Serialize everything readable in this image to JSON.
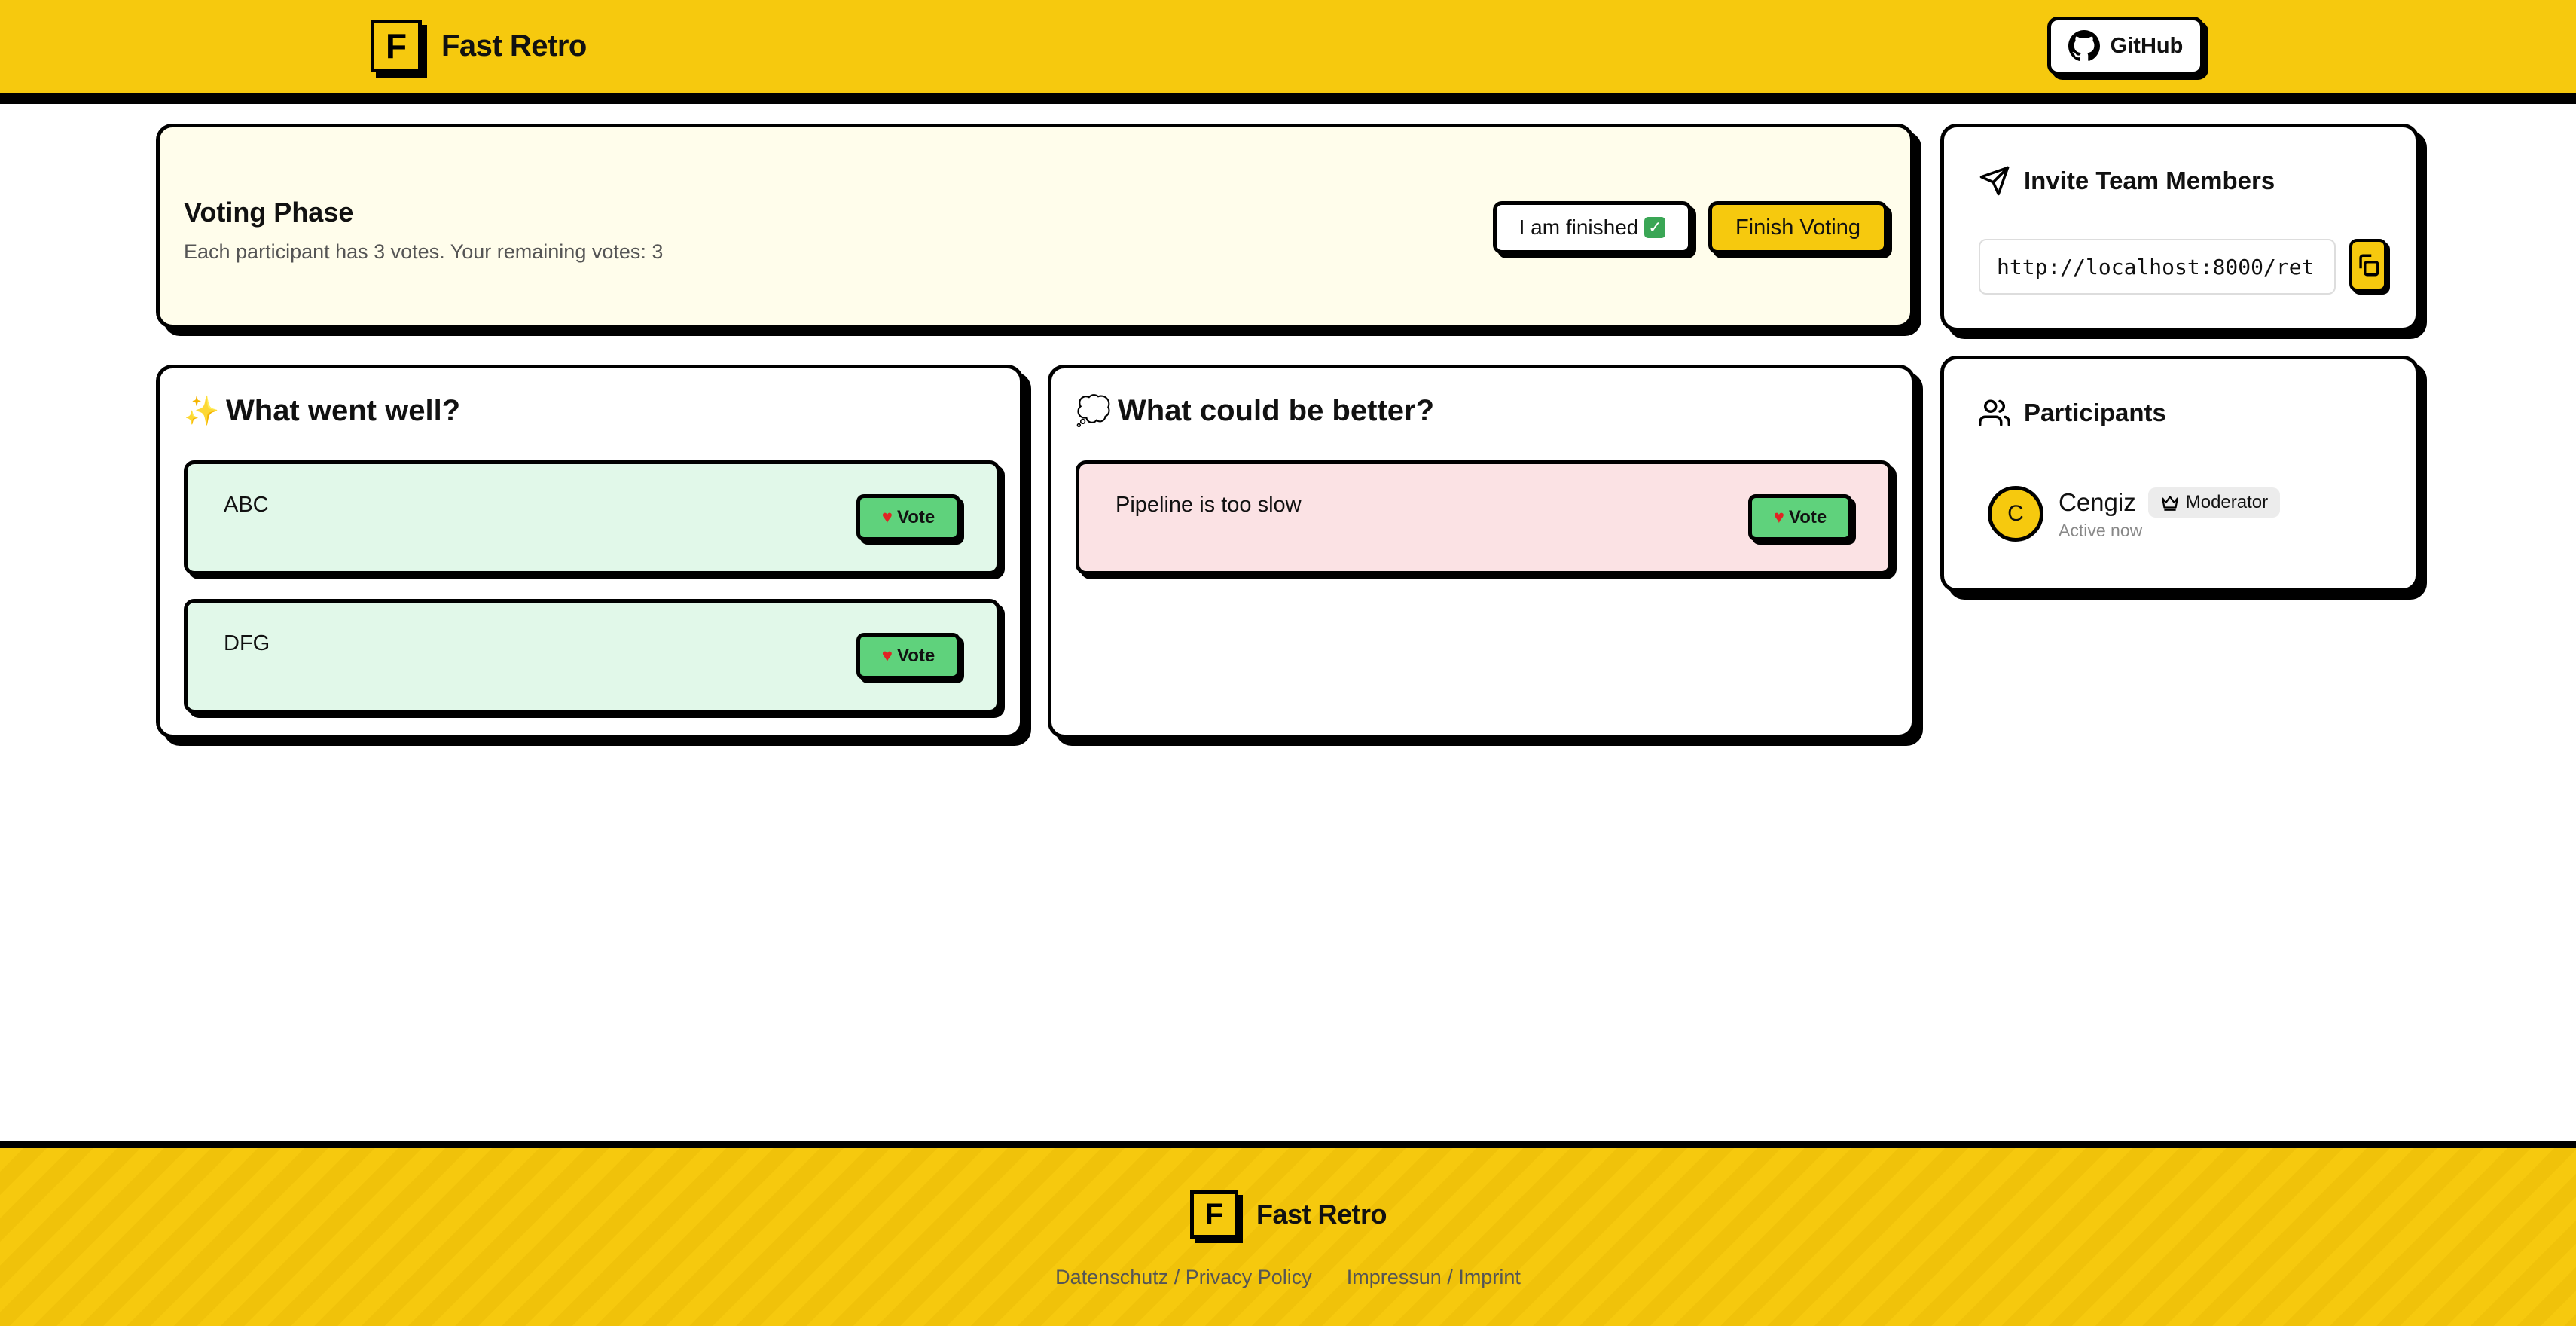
{
  "header": {
    "brand_letter": "F",
    "brand_name": "Fast Retro",
    "github_label": "GitHub"
  },
  "voting": {
    "title": "Voting Phase",
    "description": "Each participant has 3 votes. Your remaining votes: 3",
    "finished_label": "I am finished",
    "finished_icon": "check-emoji",
    "finish_voting_label": "Finish Voting"
  },
  "invite": {
    "title": "Invite Team Members",
    "url": "http://localhost:8000/ret"
  },
  "participants": {
    "title": "Participants",
    "list": [
      {
        "initial": "C",
        "name": "Cengiz",
        "role": "Moderator",
        "status": "Active now"
      }
    ]
  },
  "columns": [
    {
      "title": "What went well?",
      "icon": "sparkles-icon",
      "items": [
        {
          "text": "ABC",
          "vote_label": "Vote"
        },
        {
          "text": "DFG",
          "vote_label": "Vote"
        }
      ]
    },
    {
      "title": "What could be better?",
      "icon": "thought-bubble-icon",
      "items": [
        {
          "text": "Pipeline is too slow",
          "vote_label": "Vote"
        }
      ]
    }
  ],
  "footer": {
    "brand_letter": "F",
    "brand_name": "Fast Retro",
    "privacy_label": "Datenschutz / Privacy Policy",
    "imprint_label": "Impressun / Imprint"
  },
  "colors": {
    "brand_yellow": "#f6c90e",
    "well_item_bg": "#e1f8e9",
    "better_item_bg": "#fbe2e4",
    "vote_green": "#5fd27c"
  }
}
